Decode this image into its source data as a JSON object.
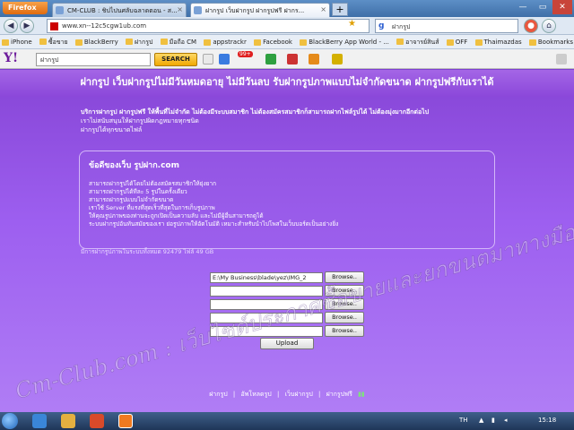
{
  "browser": {
    "menu_label": "Firefox",
    "tabs": [
      {
        "title": "CM-CLUB : ชิปไปนศลับฉลาดตอน - ส..."
      },
      {
        "title": "ฝากรูป เว็บฝากรูป ฝากรูปฟรี ฝากร..."
      }
    ],
    "new_tab": "+",
    "url": "www.xn--12c5cgw1ub.com",
    "search_value": "ฝากรูป",
    "search_engine": "g"
  },
  "bookmarks": [
    "iPhone",
    "ซื้อขาย",
    "BlackBerry",
    "ฝากรูป",
    "มือถือ CM",
    "appstrackr",
    "Facebook",
    "BlackBerry App World - ...",
    "อาจารย์สินส์",
    "OFF",
    "Thaimazdas",
    "Bookmarks"
  ],
  "yahoo": {
    "logo": "Y!",
    "query": "ฝากรูป",
    "search_label": "SEARCH",
    "mail_count": "99+"
  },
  "page": {
    "header": "ฝากรูป เว็บฝากรูปไม่มีวันหมดอายุ ไม่มีวันลบ รับฝากรูปภาพแบบไม่จำกัดขนาด ฝากรูปฟรีกับเราได้",
    "intro_lead": "บริการฝากรูป ฝากรูปฟรี ให้พื้นที่ไม่จำกัด ไม่ต้องมีระบบสมาชิก ไม่ต้องสมัครสมาชิกก็สามารถฝากไฟล์รูปได้ ไม่ต้องมุ่งมากอีกต่อไป",
    "intro_lines": [
      "เราไม่สนับสนุนให้ฝากรูปผิดกฎหมายทุกชนิด",
      "ฝากรูปได้ทุกขนาดไฟล์"
    ],
    "info_title": "ข้อดีของเว็บ รูปฝาก.com",
    "info_lines": [
      "สามารถฝากรูปได้โดยไม่ต้องสมัครสมาชิกให้ยุ่งยาก",
      "สามารถฝากรูปได้ทีละ 5 รูปในครั้งเดียว",
      "สามารถฝากรูปแบบไม่จำกัดขนาด",
      "เราใช้ Server ที่แรงที่สุดเร็วที่สุดในการเก็บรูปภาพ",
      "ให้คุณรูปภาพของท่านจะถูกเปิดเป็นความลับ และไม่มีผู้อื่นสามารถดูได้",
      "ระบบฝากรูปอันทันสมัยของเรา ย่อรูปภาพให้อัตโนมัติ เหมาะสำหรับนำไปโพสในเว็บบอร์ดเป็นอย่างยิ่ง"
    ],
    "stats": "มีการฝากรูปภาพในระบบทั้งหมด 92479 ไฟล์ 49 GB",
    "upload_fields": [
      "E:\\My Business\\blade\\yez\\IMG_2",
      "",
      "",
      "",
      ""
    ],
    "browse_label": "Browse..",
    "upload_label": "Upload",
    "footer_links": [
      "ฝากรูป",
      "อัพโหลดรูป",
      "เว็บฝากรูป",
      "ฝากรูปฟรี"
    ],
    "footer_sep": "|"
  },
  "watermark": "Cm-Club.com : เว็บไซต์ประกาศซื้อขายและยกขนตมาทางมือถือ",
  "taskbar": {
    "lang": "TH",
    "time": "15:18"
  },
  "colors": {
    "page_purple": "#8b48da",
    "header_purple": "#a466e6",
    "taskbar": "#1f3658"
  }
}
